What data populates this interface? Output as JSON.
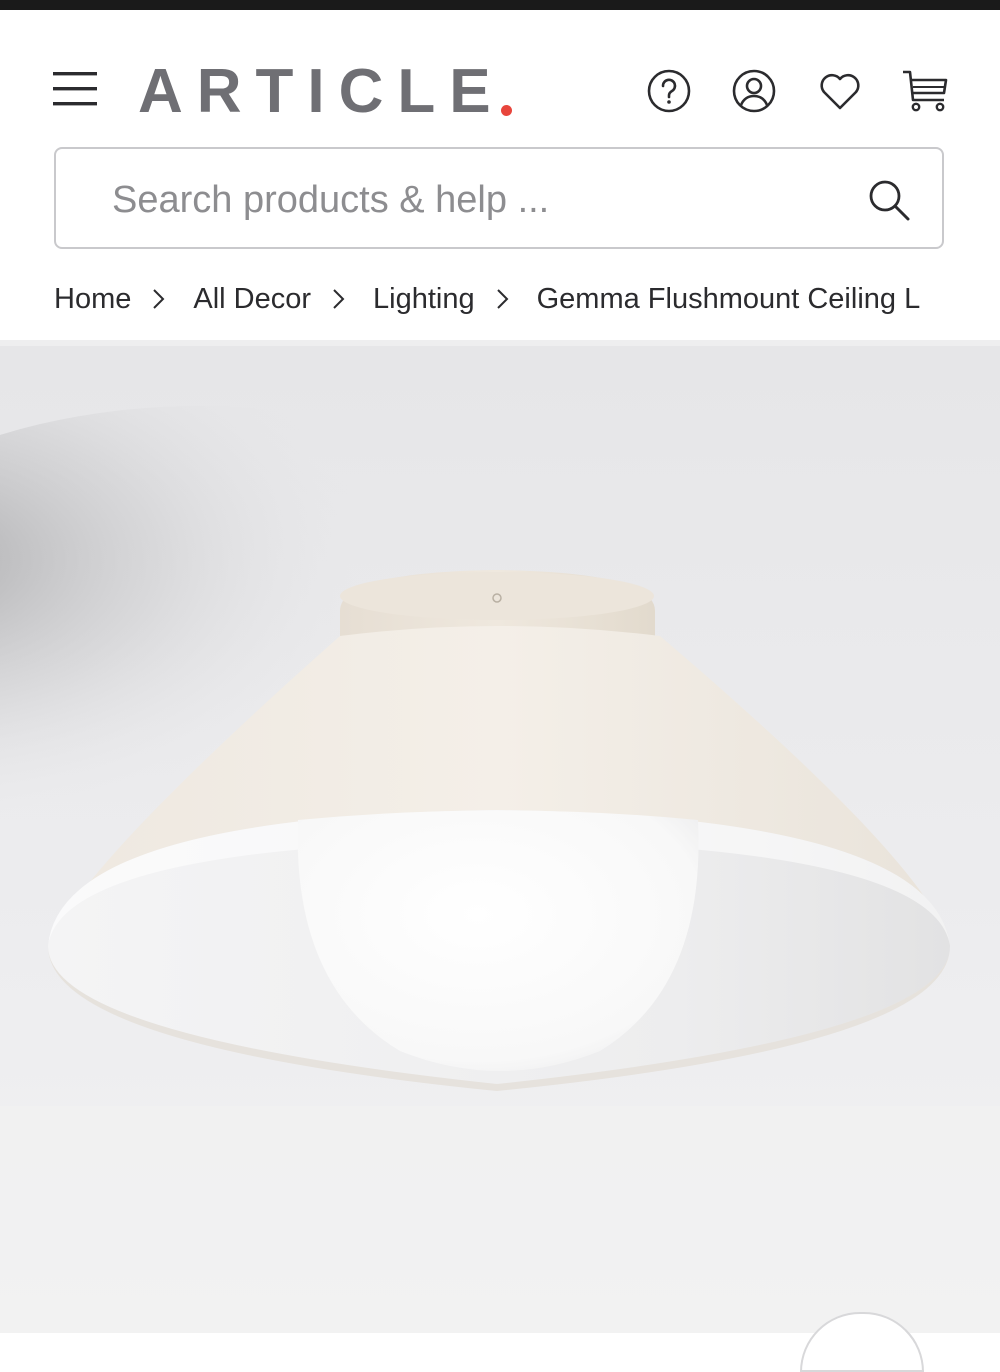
{
  "brand": {
    "name": "ARTICLE",
    "dot_color": "#e8453c",
    "text_color": "#6f6f74"
  },
  "header": {
    "icons": [
      "menu-icon",
      "help-icon",
      "account-icon",
      "heart-icon",
      "cart-icon"
    ]
  },
  "search": {
    "placeholder": "Search products & help ...",
    "value": ""
  },
  "breadcrumb": {
    "items": [
      "Home",
      "All Decor",
      "Lighting",
      "Gemma Flushmount Ceiling L"
    ]
  },
  "product": {
    "image_subject": "flushmount ceiling lamp"
  }
}
